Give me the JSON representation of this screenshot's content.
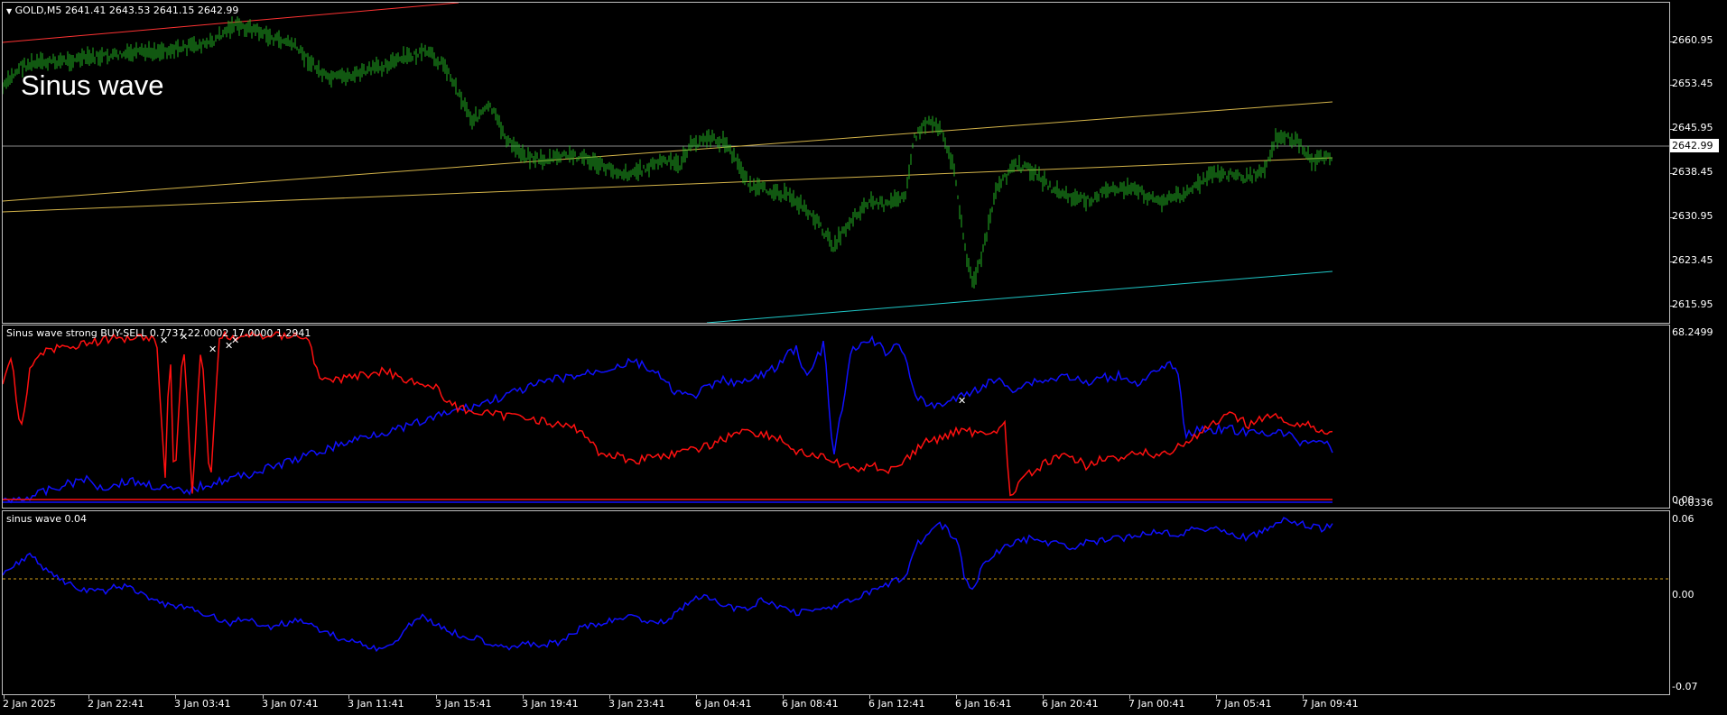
{
  "main": {
    "symbol_label": "GOLD,M5",
    "ohlc": "2641.41 2643.53 2641.15 2642.99",
    "overlay_title": "Sinus wave",
    "current_price": "2642.99",
    "price_axis": [
      "2660.95",
      "2653.45",
      "2645.95",
      "2638.45",
      "2630.95",
      "2623.45",
      "2615.95"
    ]
  },
  "indicator1": {
    "label": "Sinus wave strong BUY-SELL 0.7737 22.0002 17.0000 1.2941",
    "axis_top": "68.2499",
    "axis_bottom_a": "0.00",
    "axis_bottom_b": "-0.0336"
  },
  "indicator2": {
    "label": "sinus wave 0.04",
    "axis": [
      "0.06",
      "0.00",
      "-0.07"
    ]
  },
  "time_axis": [
    "2 Jan 2025",
    "2 Jan 22:41",
    "3 Jan 03:41",
    "3 Jan 07:41",
    "3 Jan 11:41",
    "3 Jan 15:41",
    "3 Jan 19:41",
    "3 Jan 23:41",
    "6 Jan 04:41",
    "6 Jan 08:41",
    "6 Jan 12:41",
    "6 Jan 16:41",
    "6 Jan 20:41",
    "7 Jan 00:41",
    "7 Jan 05:41",
    "7 Jan 09:41"
  ],
  "colors": {
    "price_bars": "#22b022",
    "trend_upper": "#ff3333",
    "trend_mid": "#d4b44a",
    "trend_low": "#1fc8c8",
    "blue_line": "#1010ff",
    "red_line": "#ff1010",
    "marker": "#ffffff",
    "zero_line": "#d4a017",
    "current_price_line": "#8a8a8a"
  }
}
